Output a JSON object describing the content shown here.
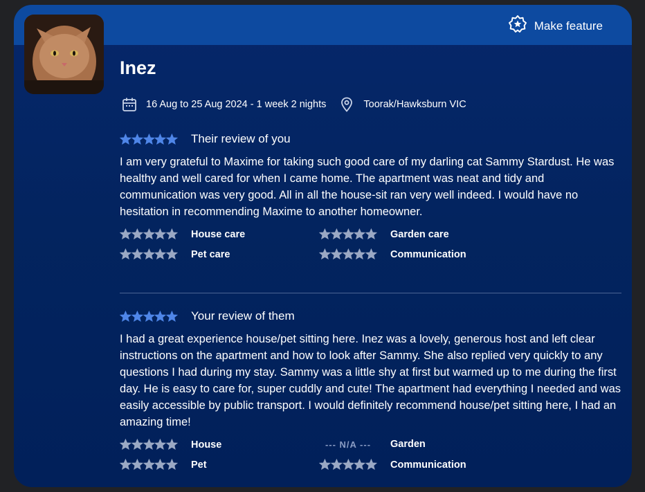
{
  "header": {
    "feature_label": "Make feature"
  },
  "profile": {
    "name": "Inez",
    "dates": "16 Aug to 25 Aug 2024 - 1 week 2 nights",
    "location": "Toorak/Hawksburn VIC"
  },
  "their_review": {
    "title": "Their review of you",
    "stars": 5,
    "text": "I am very grateful to Maxime for taking such good care of my darling cat Sammy Stardust. He was healthy and well cared for when I came home. The apartment was neat and tidy and communication was very good. All in all the house-sit ran very well indeed. I would have no hesitation in recommending Maxime to another homeowner.",
    "ratings": [
      {
        "label": "House care",
        "stars": 5
      },
      {
        "label": "Garden care",
        "stars": 5
      },
      {
        "label": "Pet care",
        "stars": 5
      },
      {
        "label": "Communication",
        "stars": 5
      }
    ]
  },
  "your_review": {
    "title": "Your review of them",
    "stars": 5,
    "text": "I had a great experience house/pet sitting here. Inez was a lovely, generous host and left clear instructions on the apartment and how to look after Sammy. She also replied very quickly to any questions I had during my stay. Sammy was a little shy at first but warmed up to me during the first day. He is easy to care for, super cuddly and cute! The apartment had everything I needed and was easily accessible by public transport. I would definitely recommend house/pet sitting here, I had an amazing time!",
    "ratings": [
      {
        "label": "House",
        "stars": 5
      },
      {
        "label": "Garden",
        "stars": null,
        "na_text": "--- N/A ---"
      },
      {
        "label": "Pet",
        "stars": 5
      },
      {
        "label": "Communication",
        "stars": 5
      }
    ]
  },
  "colors": {
    "review_star": "#4f86e8",
    "category_star": "#9aa8c4",
    "topbar": "#0d4aa0",
    "card": "#03245f"
  },
  "icons": {
    "feature": "badge-star-icon",
    "calendar": "calendar-icon",
    "location": "map-pin-icon",
    "star": "star-icon"
  }
}
